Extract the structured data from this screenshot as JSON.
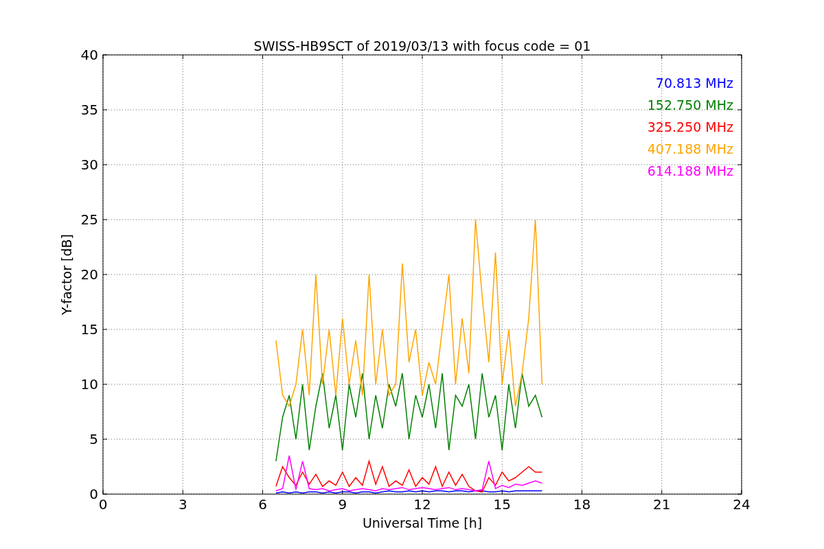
{
  "chart_data": {
    "type": "line",
    "title": "SWISS-HB9SCT of 2019/03/13 with focus code = 01",
    "xlabel": "Universal Time [h]",
    "ylabel": "Y-factor [dB]",
    "xlim": [
      0,
      24
    ],
    "ylim": [
      0,
      40
    ],
    "xticks": [
      0,
      3,
      6,
      9,
      12,
      15,
      18,
      21,
      24
    ],
    "yticks": [
      0,
      5,
      10,
      15,
      20,
      25,
      30,
      35,
      40
    ],
    "grid": true,
    "x": [
      6.5,
      6.75,
      7,
      7.25,
      7.5,
      7.75,
      8,
      8.25,
      8.5,
      8.75,
      9,
      9.25,
      9.5,
      9.75,
      10,
      10.25,
      10.5,
      10.75,
      11,
      11.25,
      11.5,
      11.75,
      12,
      12.25,
      12.5,
      12.75,
      13,
      13.25,
      13.5,
      13.75,
      14,
      14.25,
      14.5,
      14.75,
      15,
      15.25,
      15.5,
      15.75,
      16,
      16.25,
      16.5
    ],
    "series": [
      {
        "name": "70.813 MHz",
        "color": "#0000ff",
        "values": [
          0.1,
          0.2,
          0.1,
          0.2,
          0.1,
          0.2,
          0.2,
          0.1,
          0.2,
          0.1,
          0.2,
          0.2,
          0.1,
          0.2,
          0.2,
          0.1,
          0.2,
          0.3,
          0.2,
          0.2,
          0.3,
          0.2,
          0.3,
          0.2,
          0.3,
          0.3,
          0.2,
          0.3,
          0.3,
          0.2,
          0.3,
          0.3,
          0.2,
          0.2,
          0.3,
          0.2,
          0.3,
          0.3,
          0.3,
          0.3,
          0.3
        ]
      },
      {
        "name": "152.750 MHz",
        "color": "#008000",
        "values": [
          3,
          7,
          9,
          5,
          10,
          4,
          8,
          11,
          6,
          9,
          4,
          10,
          7,
          11,
          5,
          9,
          6,
          10,
          8,
          11,
          5,
          9,
          7,
          10,
          6,
          11,
          4,
          9,
          8,
          10,
          5,
          11,
          7,
          9,
          4,
          10,
          6,
          11,
          8,
          9,
          7
        ]
      },
      {
        "name": "325.250 MHz",
        "color": "#ff0000",
        "values": [
          0.7,
          2.5,
          1.5,
          0.8,
          2,
          0.9,
          1.8,
          0.7,
          1.2,
          0.8,
          2,
          0.7,
          1.5,
          0.8,
          3,
          0.9,
          2.5,
          0.7,
          1.2,
          0.8,
          2.2,
          0.7,
          1.5,
          0.9,
          2.5,
          0.7,
          2,
          0.8,
          1.8,
          0.7,
          0.3,
          0.2,
          1.5,
          0.8,
          2,
          1.2,
          1.5,
          2,
          2.5,
          2,
          2
        ]
      },
      {
        "name": "407.188 MHz",
        "color": "#ffa500",
        "values": [
          14,
          9,
          8,
          10,
          15,
          9,
          20,
          10,
          15,
          9,
          16,
          10,
          14,
          9,
          20,
          10,
          15,
          9,
          10,
          21,
          12,
          15,
          9,
          12,
          10,
          15,
          20,
          10,
          16,
          11,
          25,
          18,
          12,
          22,
          10,
          15,
          8,
          11,
          16,
          25,
          10
        ]
      },
      {
        "name": "614.188 MHz",
        "color": "#ff00ff",
        "values": [
          0.3,
          0.5,
          3.5,
          0.4,
          3,
          0.5,
          0.4,
          0.5,
          0.3,
          0.4,
          0.5,
          0.3,
          0.4,
          0.5,
          0.4,
          0.3,
          0.5,
          0.4,
          0.5,
          0.6,
          0.4,
          0.5,
          0.6,
          0.5,
          0.4,
          0.5,
          0.6,
          0.4,
          0.5,
          0.4,
          0.3,
          0.4,
          3,
          0.5,
          0.8,
          0.6,
          0.9,
          0.8,
          1,
          1.2,
          1
        ]
      }
    ]
  }
}
